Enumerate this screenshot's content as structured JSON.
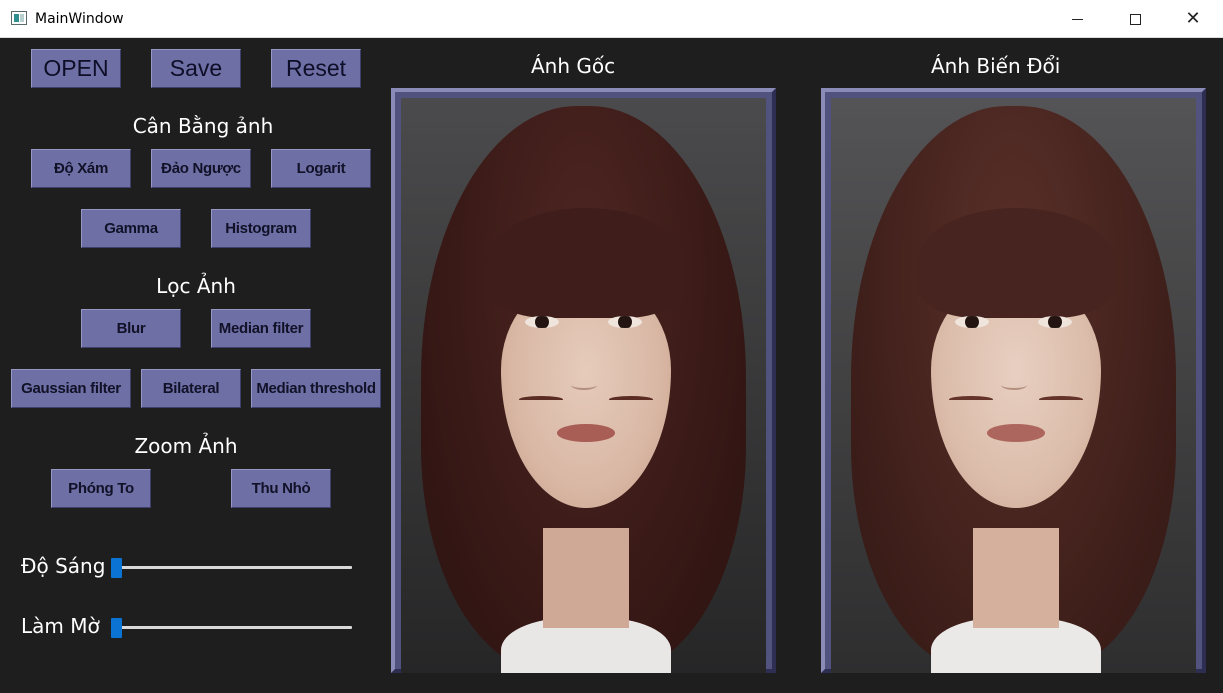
{
  "window": {
    "title": "MainWindow",
    "minimize_icon": "minimize-icon",
    "maximize_icon": "maximize-icon",
    "close_icon": "close-icon",
    "close_glyph": "✕"
  },
  "toolbar": {
    "open_label": "OPEN",
    "save_label": "Save",
    "reset_label": "Reset"
  },
  "balance": {
    "title": "Cân Bằng ảnh",
    "gray_label": "Độ Xám",
    "invert_label": "Đảo Ngược",
    "log_label": "Logarit",
    "gamma_label": "Gamma",
    "histogram_label": "Histogram"
  },
  "filter": {
    "title": "Lọc Ảnh",
    "blur_label": "Blur",
    "median_label": "Median filter",
    "gaussian_label": "Gaussian filter",
    "bilateral_label": "Bilateral",
    "median_threshold_label": "Median threshold"
  },
  "zoom": {
    "title": "Zoom Ảnh",
    "zoom_in_label": "Phóng To",
    "zoom_out_label": "Thu Nhỏ"
  },
  "sliders": {
    "brightness_label": "Độ Sáng",
    "brightness_value": 0,
    "blur_label": "Làm Mờ",
    "blur_value": 0
  },
  "images": {
    "original_title": "Ánh Gốc",
    "transformed_title": "Ánh Biến Đổi"
  },
  "colors": {
    "background": "#1e1e1e",
    "button": "#6e6fa5",
    "frame": "#52527e",
    "slider_handle": "#0a73d4"
  }
}
